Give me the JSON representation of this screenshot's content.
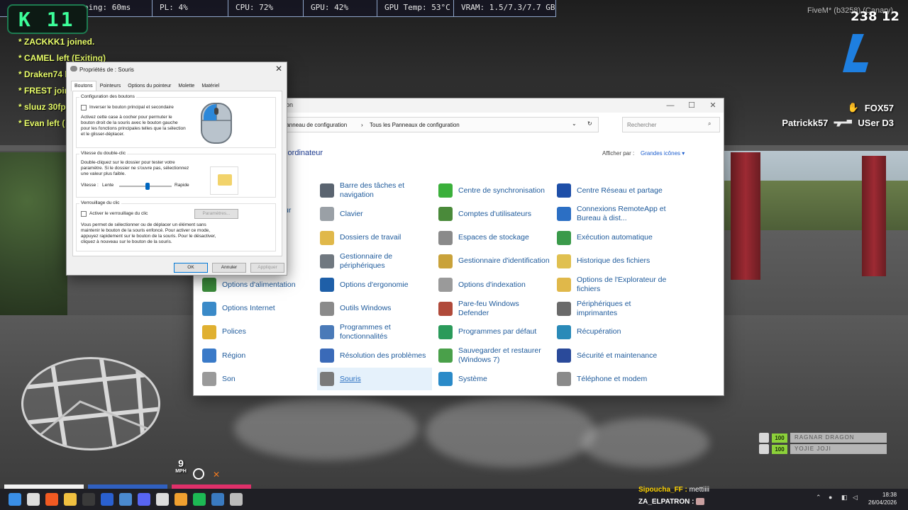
{
  "hud": {
    "stats": [
      "ping: 60ms",
      "PL: 4%",
      "CPU: 72%",
      "GPU: 42%",
      "GPU Temp: 53°C",
      "VRAM: 1.5/7.3/7.7 GB"
    ],
    "k_badge": "K 11",
    "fivem_label": "FiveM* (b3258) (Canary)",
    "player_count": "238 12",
    "feed": [
      "* ZACKKK1 joined.",
      "* CAMEL left (Exiting)",
      "* Draken74 l",
      "* FREST join",
      "* sluuz 30fp",
      "* Evan left ("
    ],
    "killfeed": [
      {
        "killer": "",
        "victim": "FOX57"
      },
      {
        "killer": "Patrickk57",
        "victim": "USer D3"
      }
    ],
    "speed": "9",
    "speed_unit": "MPH",
    "players": [
      {
        "hp": "100",
        "name": "RAGNAR DRAGON"
      },
      {
        "hp": "100",
        "name": "YOJIE JOJI"
      }
    ],
    "chat": [
      {
        "name": "Sipoucha_FF :",
        "msg": " mettiiii"
      },
      {
        "name": "ZA_ELPATRON :",
        "msg": ""
      }
    ]
  },
  "control_panel": {
    "title_fragment": "ion",
    "breadcrumb": [
      "Panneau de configuration",
      "Tous les Panneaux de configuration"
    ],
    "search_placeholder": "Rechercher",
    "heading": "l'ordinateur",
    "view_by_label": "Afficher par :",
    "view_by_value": "Grandes icônes",
    "partial_label_1": "ur",
    "items": [
      {
        "label": "Barre des tâches et navigation",
        "icon": "taskbar-icon",
        "color": "#5a6470"
      },
      {
        "label": "Centre de synchronisation",
        "icon": "sync-icon",
        "color": "#3bb03b"
      },
      {
        "label": "Centre Réseau et partage",
        "icon": "network-icon",
        "color": "#1e4fa8"
      },
      {
        "label": "Clavier",
        "icon": "keyboard-icon",
        "color": "#9aa0a6"
      },
      {
        "label": "Comptes d'utilisateurs",
        "icon": "users-icon",
        "color": "#4a8a3a"
      },
      {
        "label": "Connexions RemoteApp et Bureau à dist...",
        "icon": "remote-icon",
        "color": "#2c6fc4"
      },
      {
        "label": "Dossiers de travail",
        "icon": "workfolders-icon",
        "color": "#e0b84a"
      },
      {
        "label": "Espaces de stockage",
        "icon": "storage-icon",
        "color": "#8a8a8a"
      },
      {
        "label": "Exécution automatique",
        "icon": "autoplay-icon",
        "color": "#3a9a4a"
      },
      {
        "label": "Gestionnaire de périphériques",
        "icon": "devmgr-icon",
        "color": "#707880"
      },
      {
        "label": "Gestionnaire d'identification",
        "icon": "credential-icon",
        "color": "#c9a23a"
      },
      {
        "label": "Historique des fichiers",
        "icon": "filehistory-icon",
        "color": "#e0c050"
      },
      {
        "label": "Options d'alimentation",
        "icon": "power-icon",
        "color": "#3a8a3a"
      },
      {
        "label": "Options d'ergonomie",
        "icon": "ease-icon",
        "color": "#1e5fa8"
      },
      {
        "label": "Options d'indexation",
        "icon": "indexing-icon",
        "color": "#9a9a9a"
      },
      {
        "label": "Options de l'Explorateur de fichiers",
        "icon": "explorer-options-icon",
        "color": "#e0b84a"
      },
      {
        "label": "Options Internet",
        "icon": "internet-icon",
        "color": "#3a8ac8"
      },
      {
        "label": "Outils Windows",
        "icon": "tools-icon",
        "color": "#8a8a8a"
      },
      {
        "label": "Pare-feu Windows Defender",
        "icon": "firewall-icon",
        "color": "#b04a3a"
      },
      {
        "label": "Périphériques et imprimantes",
        "icon": "printer-icon",
        "color": "#6a6a6a"
      },
      {
        "label": "Polices",
        "icon": "fonts-icon",
        "color": "#e0b030"
      },
      {
        "label": "Programmes et fonctionnalités",
        "icon": "programs-icon",
        "color": "#4a7ab8"
      },
      {
        "label": "Programmes par défaut",
        "icon": "default-programs-icon",
        "color": "#2a9a5a"
      },
      {
        "label": "Récupération",
        "icon": "recovery-icon",
        "color": "#2a8ab8"
      },
      {
        "label": "Région",
        "icon": "region-icon",
        "color": "#3a7ac8"
      },
      {
        "label": "Résolution des problèmes",
        "icon": "troubleshoot-icon",
        "color": "#3a6ab8"
      },
      {
        "label": "Sauvegarder et restaurer (Windows 7)",
        "icon": "backup-icon",
        "color": "#4aa04a"
      },
      {
        "label": "Sécurité et maintenance",
        "icon": "security-icon",
        "color": "#2a4a9a"
      },
      {
        "label": "Son",
        "icon": "sound-icon",
        "color": "#9a9a9a"
      },
      {
        "label": "Souris",
        "icon": "mouse-icon",
        "color": "#7a7a7a"
      },
      {
        "label": "Système",
        "icon": "system-icon",
        "color": "#2a8ac8"
      },
      {
        "label": "Téléphone et modem",
        "icon": "phone-icon",
        "color": "#8a8a8a"
      }
    ]
  },
  "mouse_props": {
    "title": "Propriétés de : Souris",
    "tabs": [
      "Boutons",
      "Pointeurs",
      "Options du pointeur",
      "Molette",
      "Matériel"
    ],
    "group1_title": "Configuration des boutons",
    "swap_label": "Inverser le bouton principal et secondaire",
    "swap_desc": "Activez cette case à cocher pour permuter le bouton droit de la souris avec le bouton gauche pour les fonctions principales telles que la sélection et le glisser-déplacer.",
    "group2_title": "Vitesse du double-clic",
    "dbl_desc": "Double-cliquez sur le dossier pour tester votre paramètre. Si le dossier ne s'ouvre pas, sélectionnez une valeur plus faible.",
    "speed_label": "Vitesse :",
    "slow": "Lente",
    "fast": "Rapide",
    "double_click_speed": 0.55,
    "group3_title": "Verrouillage du clic",
    "lock_label": "Activer le verrouillage du clic",
    "settings_btn": "Paramètres...",
    "lock_desc": "Vous permet de sélectionner ou de déplacer un élément sans maintenir le bouton de la souris enfoncé. Pour activer ce mode, appuyez rapidement sur le bouton de la souris. Pour le désactiver, cliquez à nouveau sur le bouton de la souris.",
    "ok": "OK",
    "cancel": "Annuler",
    "apply": "Appliquer"
  },
  "taskbar": {
    "time": "18:38",
    "date": "26/04/2026",
    "icons": [
      "start-icon",
      "search-icon",
      "brave-icon",
      "file-explorer-icon",
      "terminal-icon",
      "app-icon",
      "browser-icon",
      "discord-icon",
      "settings-icon",
      "app2-icon",
      "spotify-icon",
      "remote-icon",
      "mouse-icon"
    ]
  }
}
